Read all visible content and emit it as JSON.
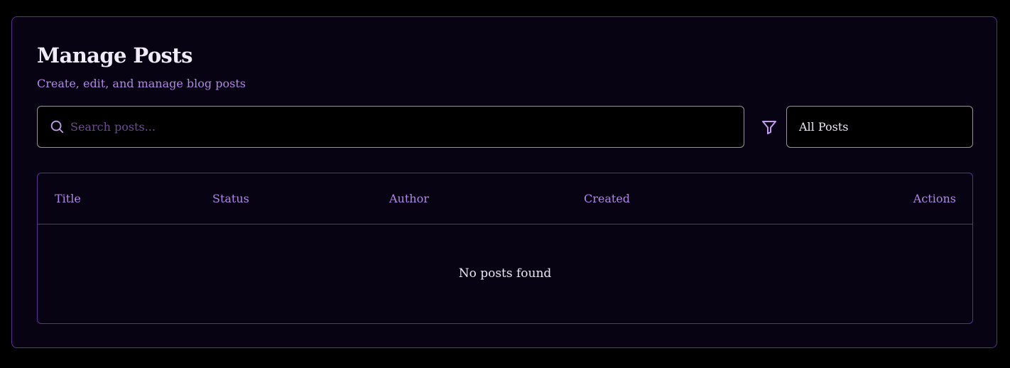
{
  "header": {
    "title": "Manage Posts",
    "subtitle": "Create, edit, and manage blog posts"
  },
  "toolbar": {
    "search_placeholder": "Search posts...",
    "search_value": "",
    "search_icon": "search-icon",
    "filter_icon": "filter-icon",
    "status_filter_selected": "All Posts"
  },
  "table": {
    "columns": [
      "Title",
      "Status",
      "Author",
      "Created",
      "Actions"
    ],
    "rows": [],
    "empty_message": "No posts found"
  },
  "colors": {
    "background": "#000000",
    "card_background": "#070312",
    "accent_border": "#5b3290",
    "accent_text": "#b286e6",
    "input_border": "#9a9496",
    "primary_text": "#f1eaf7"
  }
}
